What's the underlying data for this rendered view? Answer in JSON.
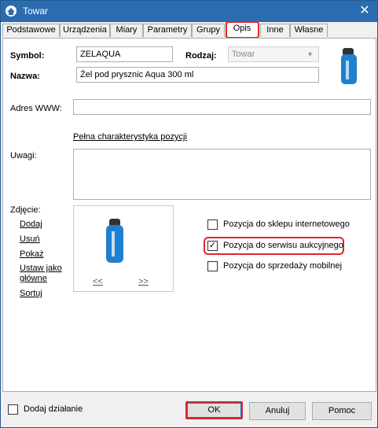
{
  "window": {
    "title": "Towar",
    "close": "✕"
  },
  "tabs": [
    {
      "label": "Podstawowe"
    },
    {
      "label": "Urządzenia"
    },
    {
      "label": "Miary"
    },
    {
      "label": "Parametry"
    },
    {
      "label": "Grupy"
    },
    {
      "label": "Opis"
    },
    {
      "label": "Inne"
    },
    {
      "label": "Własne"
    }
  ],
  "active_tab": "Opis",
  "form": {
    "symbol_label": "Symbol:",
    "symbol_value": "ZELAQUA",
    "rodzaj_label": "Rodzaj:",
    "rodzaj_value": "Towar",
    "nazwa_label": "Nazwa:",
    "nazwa_value": "Żel pod prysznic Aqua 300 ml",
    "www_label": "Adres WWW:",
    "www_value": "",
    "full_spec_link": "Pełna charakterystyka pozycji",
    "uwagi_label": "Uwagi:",
    "uwagi_value": ""
  },
  "photo": {
    "label": "Zdjęcie:",
    "actions": [
      "Dodaj",
      "Usuń",
      "Pokaż",
      "Ustaw jako główne",
      "Sortuj"
    ],
    "prev": "<<",
    "next": ">>"
  },
  "options": [
    {
      "label": "Pozycja do sklepu internetowego",
      "checked": false
    },
    {
      "label": "Pozycja do serwisu aukcyjnego",
      "checked": true
    },
    {
      "label": "Pozycja do sprzedaży mobilnej",
      "checked": false
    }
  ],
  "footer": {
    "add_action_label": "Dodaj działanie",
    "add_action_checked": false,
    "ok": "OK",
    "cancel": "Anuluj",
    "help": "Pomoc"
  },
  "colors": {
    "accent": "#2b6cb0",
    "highlight": "#e0262d",
    "product": "#1f7fd1"
  }
}
